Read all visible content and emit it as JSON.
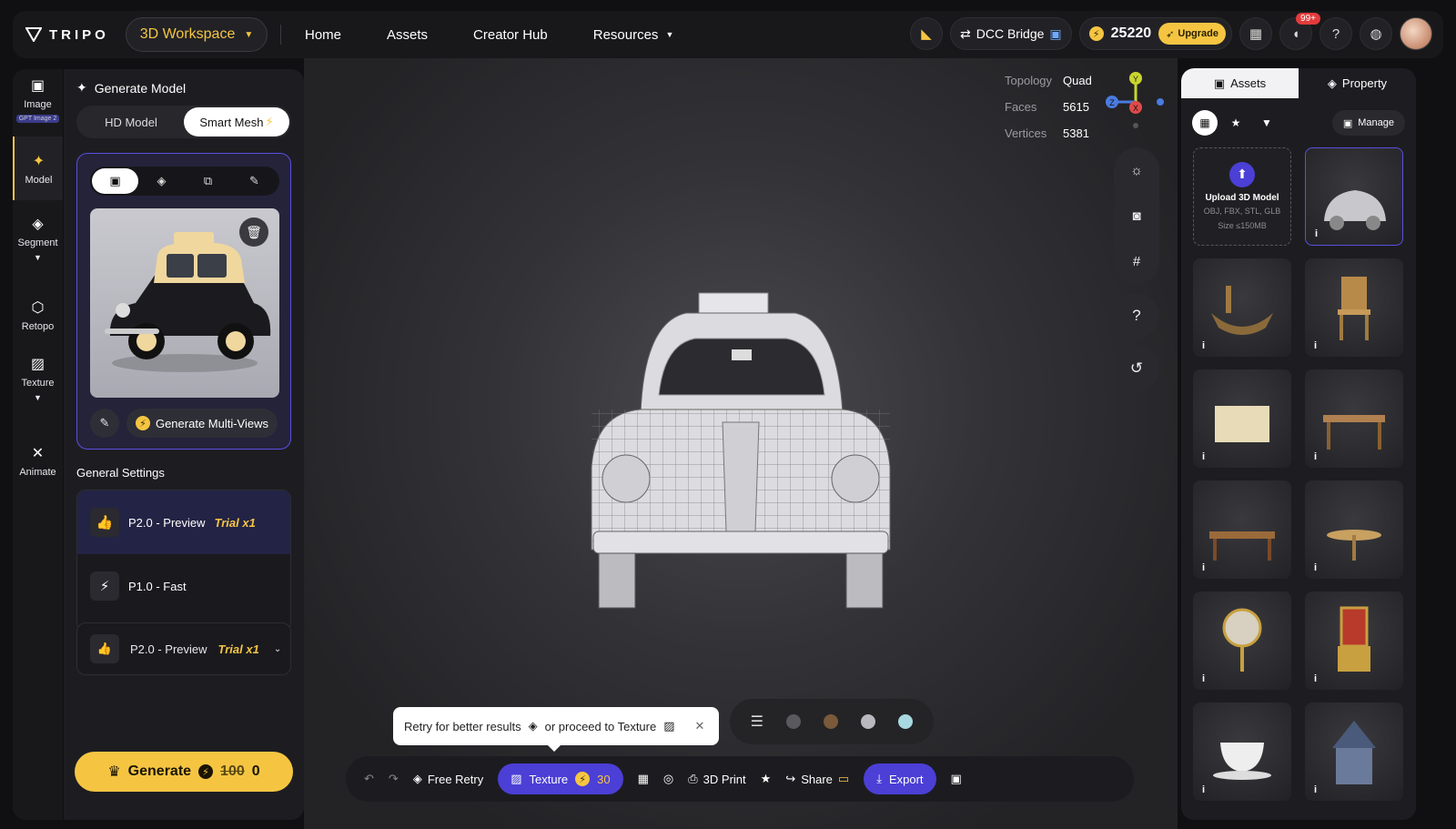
{
  "topbar": {
    "brand": "TRIPO",
    "workspace": "3D Workspace",
    "nav": [
      "Home",
      "Assets",
      "Creator Hub",
      "Resources"
    ],
    "dcc_bridge": "DCC Bridge",
    "credits": "25220",
    "upgrade": "Upgrade",
    "notifications_badge": "99+"
  },
  "left_rail": [
    {
      "label": "Image",
      "badge": "GPT Image 2"
    },
    {
      "label": "Model"
    },
    {
      "label": "Segment"
    },
    {
      "label": "Retopo"
    },
    {
      "label": "Texture"
    },
    {
      "label": "Animate"
    }
  ],
  "panel": {
    "title": "Generate Model",
    "modes": [
      "HD Model",
      "Smart Mesh"
    ],
    "multi_views": "Generate Multi-Views",
    "general_settings": "General Settings",
    "models": [
      {
        "name": "P2.0 - Preview",
        "trial": "Trial x1"
      },
      {
        "name": "P1.0 - Fast",
        "trial": ""
      }
    ],
    "selected_model": {
      "name": "P2.0 - Preview",
      "trial": "Trial x1"
    },
    "generate": {
      "label": "Generate",
      "old_cost": "100",
      "cost": "0"
    }
  },
  "viewport": {
    "stats": [
      {
        "k": "Topology",
        "v": "Quad"
      },
      {
        "k": "Faces",
        "v": "5615"
      },
      {
        "k": "Vertices",
        "v": "5381"
      }
    ],
    "axes": [
      "Y",
      "Z",
      "X"
    ],
    "tooltip": {
      "retry": "Retry for better results",
      "proceed": "or proceed to Texture"
    },
    "material_colors": [
      "#5a5a5e",
      "#7a5a3a",
      "#b8b8be",
      "#a8d8e0"
    ],
    "toolbar": {
      "free_retry": "Free Retry",
      "texture": "Texture",
      "texture_cost": "30",
      "print": "3D Print",
      "share": "Share",
      "export": "Export"
    }
  },
  "right_panel": {
    "tabs": [
      "Assets",
      "Property"
    ],
    "manage": "Manage",
    "upload": {
      "title": "Upload 3D Model",
      "formats": "OBJ, FBX, STL, GLB",
      "size": "Size ≤150MB"
    },
    "assets": [
      "taxi",
      "boat",
      "chair",
      "crate",
      "desk",
      "writing-desk",
      "bistro-table",
      "mirror",
      "throne",
      "teacup",
      "house"
    ]
  }
}
